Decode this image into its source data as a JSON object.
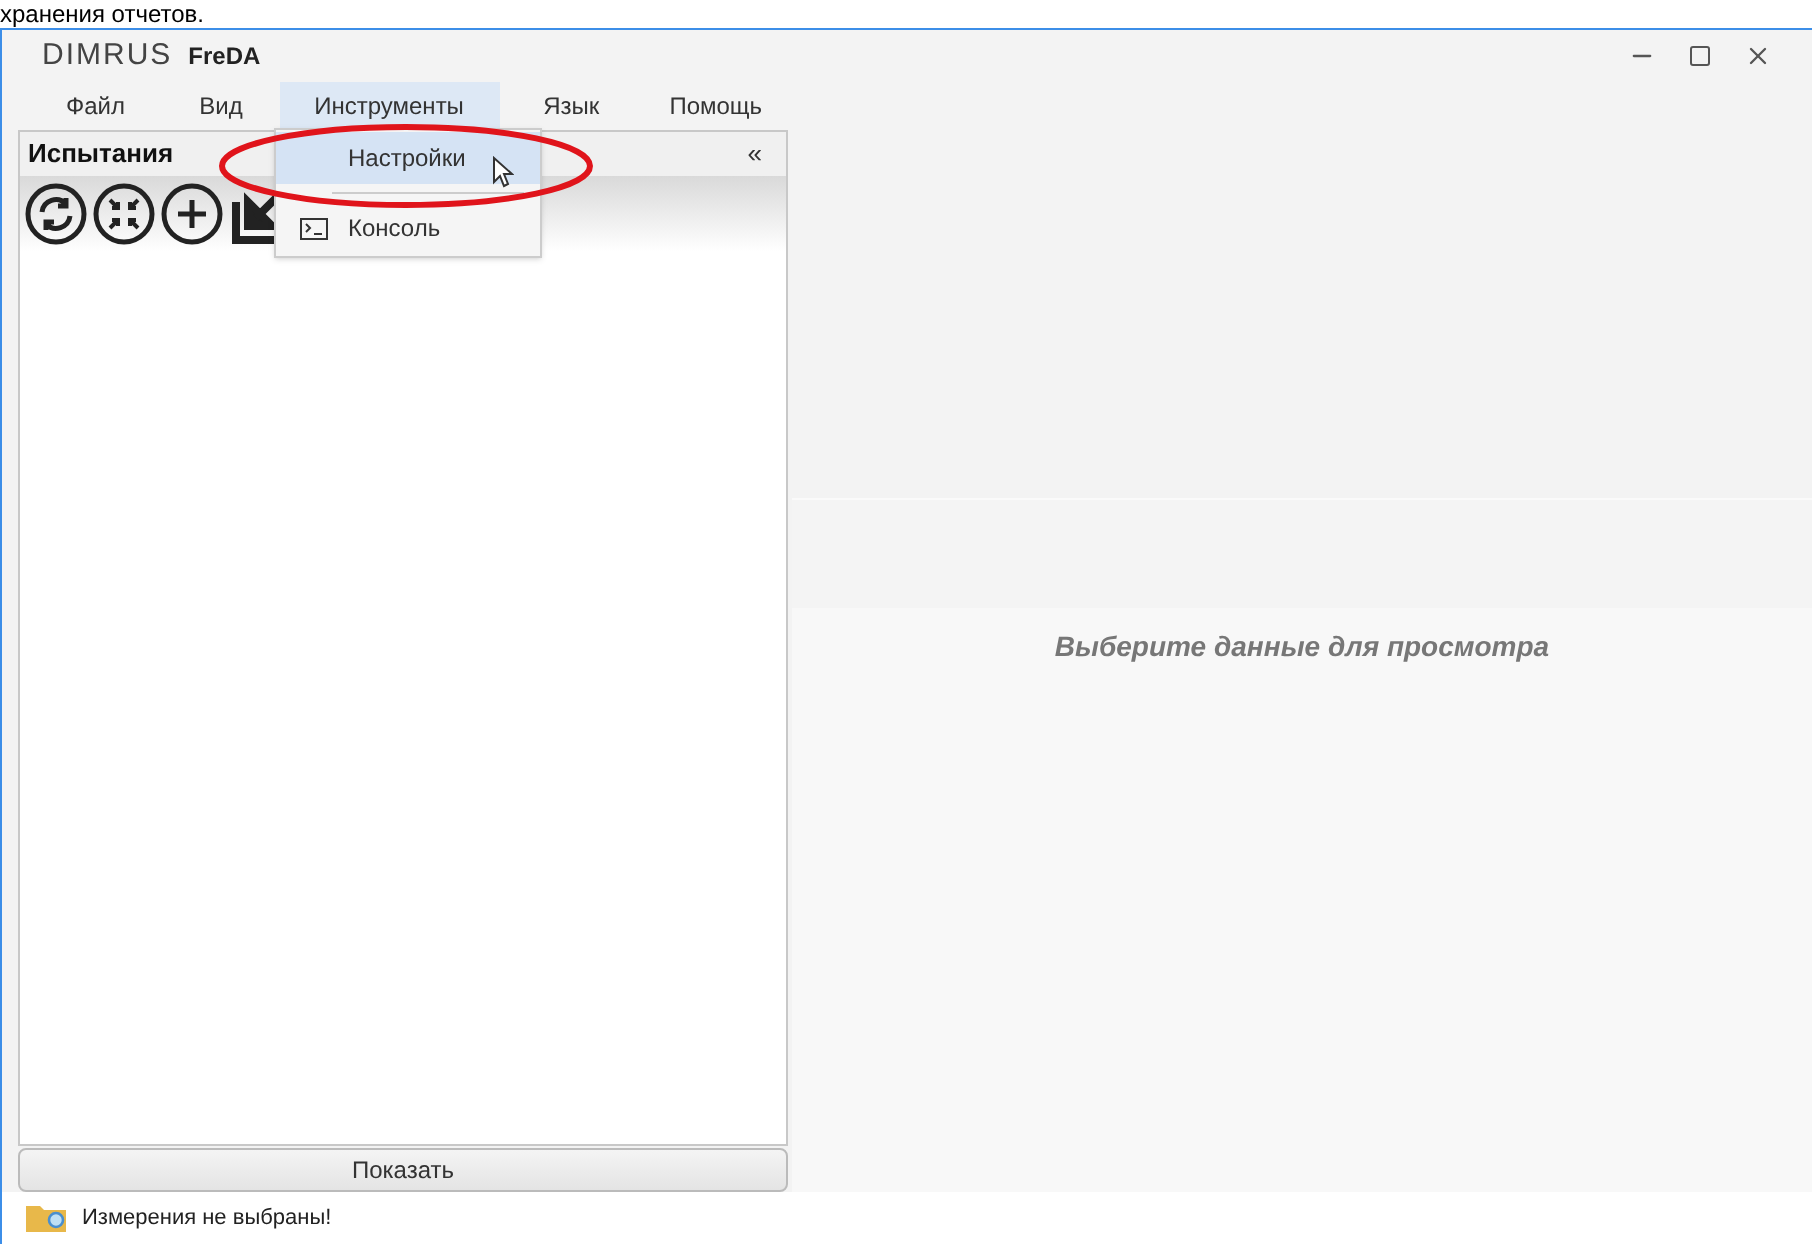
{
  "page_fragment": {
    "text": "хранения отчетов."
  },
  "window": {
    "logo": "DIMRUS",
    "title": "FreDA"
  },
  "menu": [
    {
      "label": "Файл",
      "selected": false
    },
    {
      "label": "Вид",
      "selected": false
    },
    {
      "label": "Инструменты",
      "selected": true
    },
    {
      "label": "Язык",
      "selected": false
    },
    {
      "label": "Помощь",
      "selected": false
    }
  ],
  "dropdown": [
    {
      "kind": "item",
      "label": "Настройки",
      "selected": true
    },
    {
      "kind": "separator"
    },
    {
      "kind": "item_with_icon",
      "label": "Консоль",
      "selected": false
    }
  ],
  "panel": {
    "title": "Испытания",
    "collapse": "«",
    "button": "Показать"
  },
  "viewer": {
    "message": "Выберите данные для просмотра"
  },
  "status_bar": {
    "text": "Измерения не выбраны!"
  }
}
